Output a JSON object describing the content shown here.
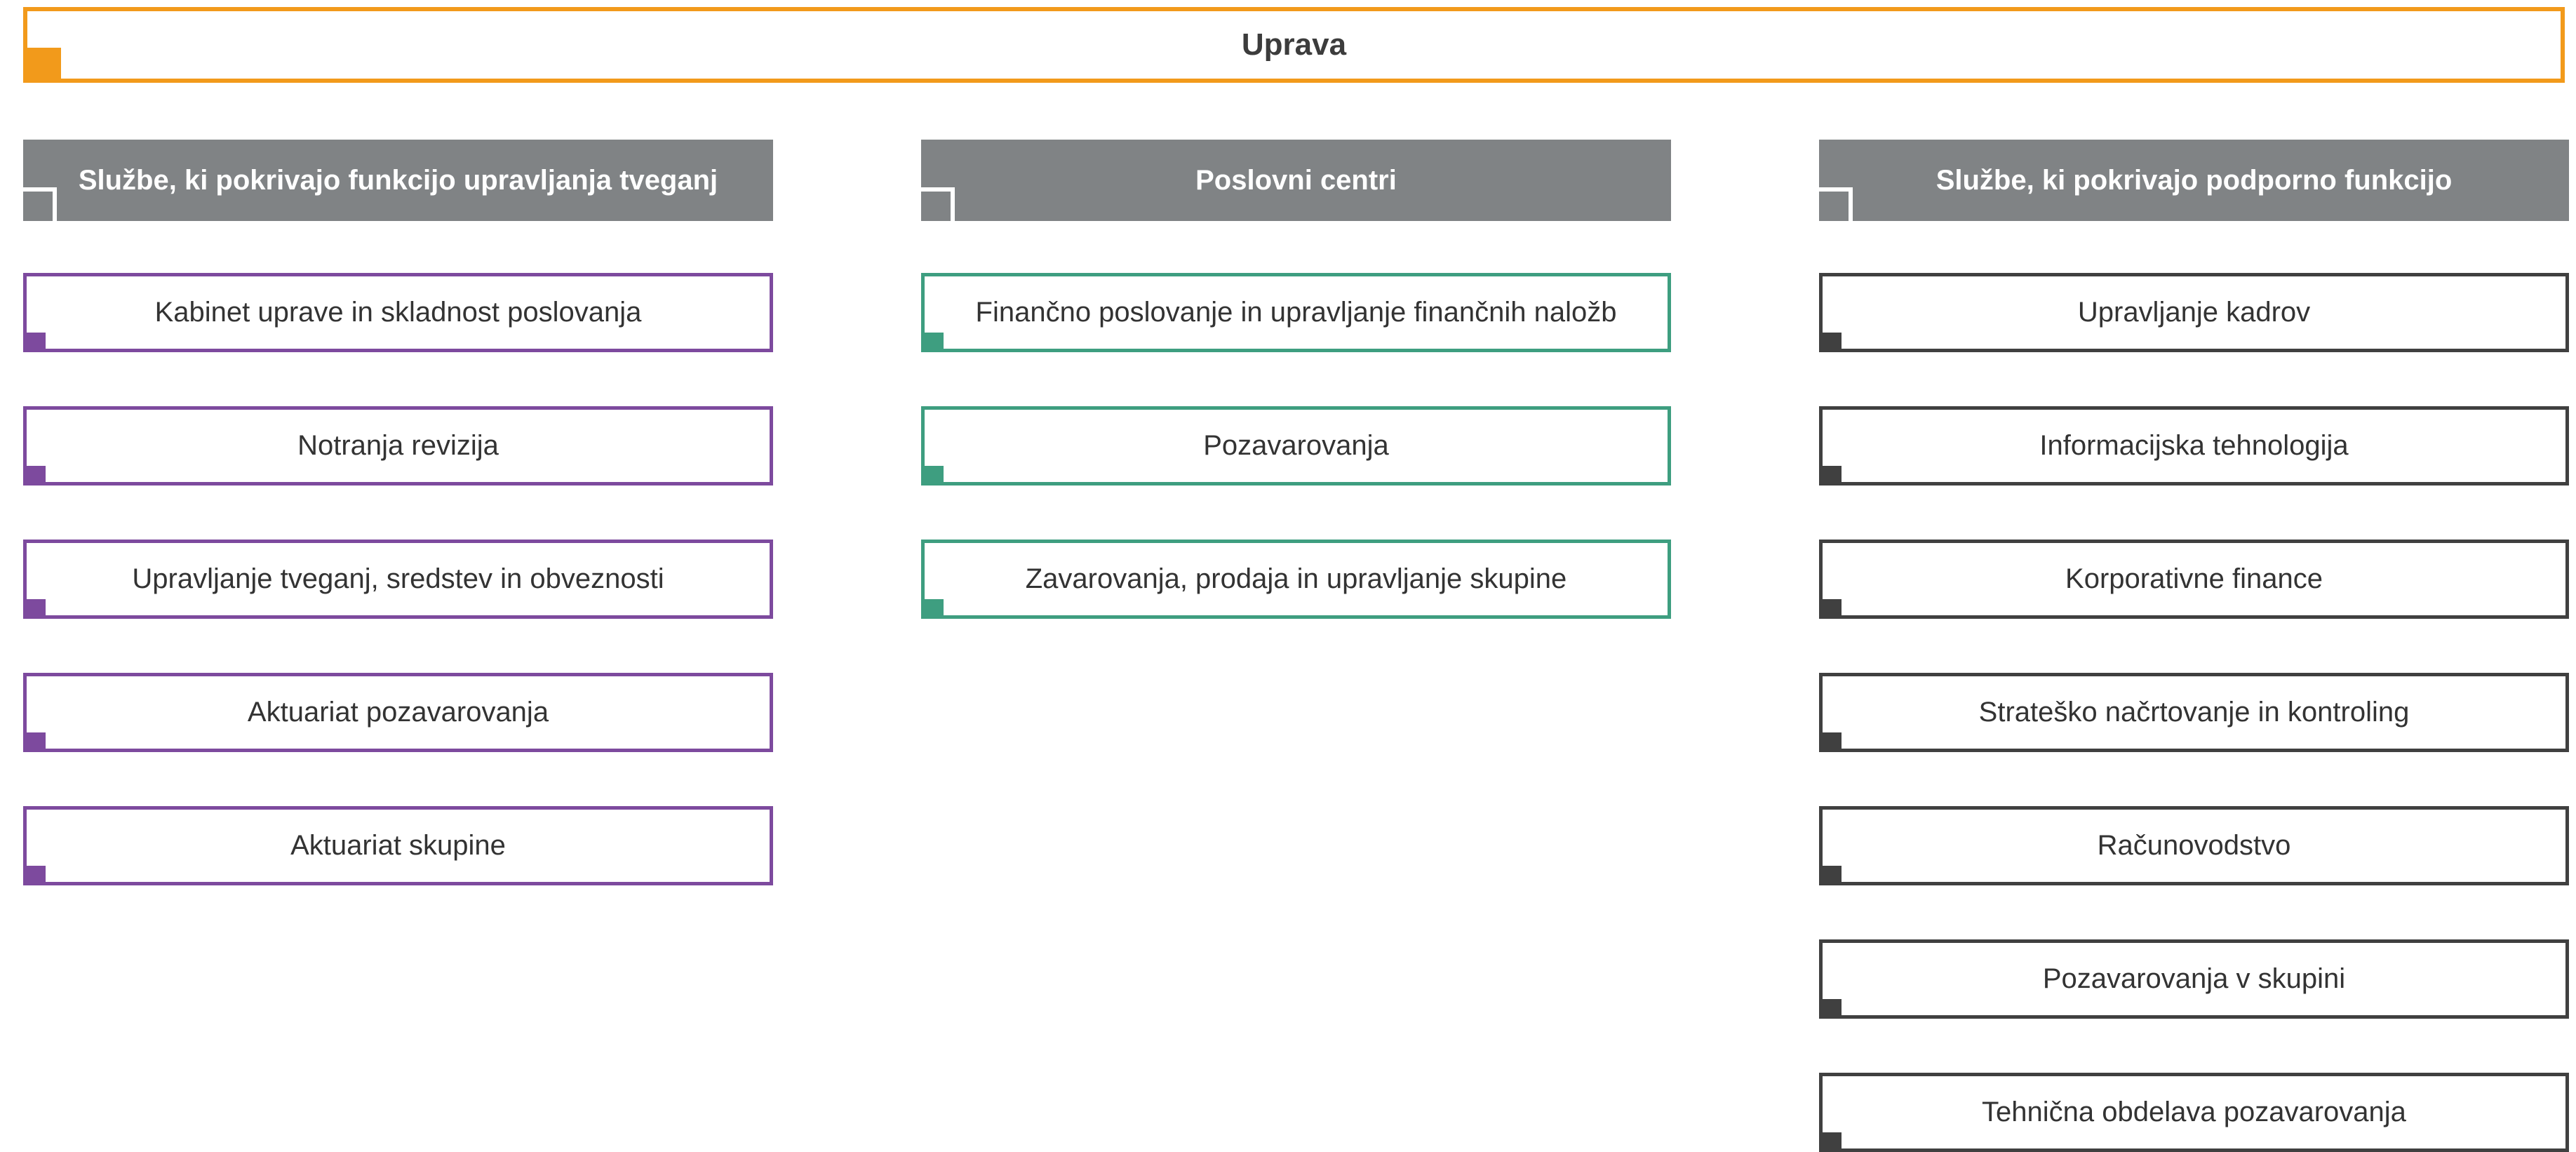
{
  "top": {
    "title": "Uprava"
  },
  "colors": {
    "top": "#f29a1b",
    "header": "#808385",
    "col1": "#7d4a9e",
    "col2": "#3e9e80",
    "col3": "#404040"
  },
  "columns": [
    {
      "header": "Službe, ki pokrivajo funkcijo upravljanja tveganj",
      "items": [
        "Kabinet uprave in skladnost poslovanja",
        "Notranja revizija",
        "Upravljanje tveganj, sredstev in obveznosti",
        "Aktuariat pozavarovanja",
        "Aktuariat skupine"
      ]
    },
    {
      "header": "Poslovni centri",
      "items": [
        "Finančno poslovanje in upravljanje finančnih naložb",
        "Pozavarovanja",
        "Zavarovanja, prodaja in upravljanje skupine"
      ]
    },
    {
      "header": "Službe, ki pokrivajo podporno funkcijo",
      "items": [
        "Upravljanje kadrov",
        "Informacijska tehnologija",
        "Korporativne finance",
        "Strateško načrtovanje in kontroling",
        "Računovodstvo",
        "Pozavarovanja v skupini",
        "Tehnična obdelava pozavarovanja"
      ]
    }
  ]
}
